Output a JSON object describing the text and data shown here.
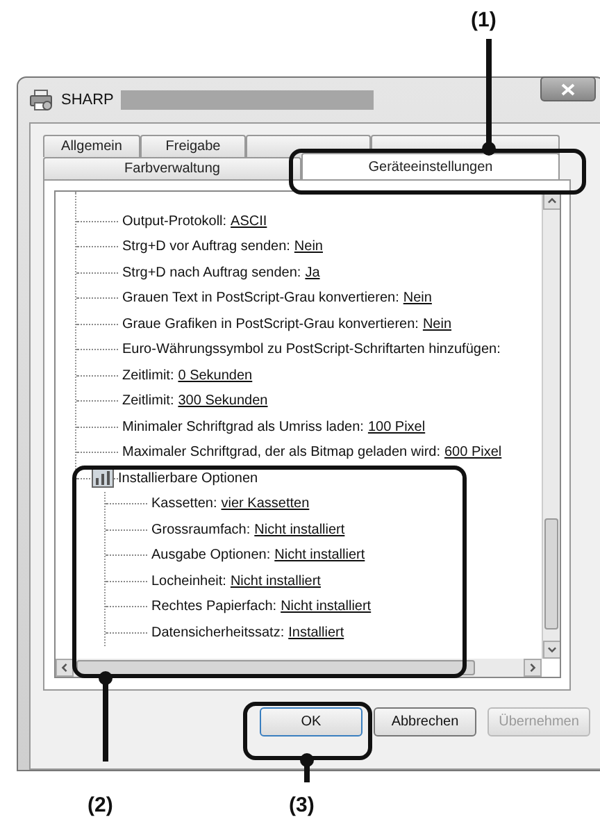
{
  "window": {
    "title": "SHARP"
  },
  "tabs_top": [
    {
      "label": "Allgemein",
      "selected": false
    },
    {
      "label": "Freigabe",
      "selected": false
    }
  ],
  "tabs_bottom": [
    {
      "label": "Farbverwaltung",
      "selected": false
    },
    {
      "label": "Geräteeinstellungen",
      "selected": true
    }
  ],
  "tree": [
    {
      "label": "Output-Protokoll:",
      "value": "ASCII"
    },
    {
      "label": "Strg+D vor Auftrag senden:",
      "value": "Nein"
    },
    {
      "label": "Strg+D nach Auftrag senden:",
      "value": "Ja"
    },
    {
      "label": "Grauen Text in PostScript-Grau konvertieren:",
      "value": "Nein"
    },
    {
      "label": "Graue Grafiken in PostScript-Grau konvertieren:",
      "value": "Nein"
    },
    {
      "label": "Euro-Währungssymbol zu PostScript-Schriftarten hinzufügen:"
    },
    {
      "label": "Zeitlimit:",
      "value": "0 Sekunden"
    },
    {
      "label": "Zeitlimit:",
      "value": "300 Sekunden"
    },
    {
      "label": "Minimaler Schriftgrad als Umriss laden:",
      "value": "100 Pixel"
    },
    {
      "label": "Maximaler Schriftgrad, der als Bitmap geladen wird:",
      "value": "600 Pixel"
    },
    {
      "label": "Installierbare Optionen",
      "children": [
        {
          "label": "Kassetten:",
          "value": "vier Kassetten"
        },
        {
          "label": "Grossraumfach:",
          "value": "Nicht installiert"
        },
        {
          "label": "Ausgabe Optionen:",
          "value": "Nicht installiert"
        },
        {
          "label": "Locheinheit:",
          "value": "Nicht installiert"
        },
        {
          "label": "Rechtes Papierfach:",
          "value": "Nicht installiert"
        },
        {
          "label": "Datensicherheitssatz:",
          "value": "Installiert"
        }
      ]
    }
  ],
  "buttons": [
    {
      "label": "OK",
      "default": true,
      "disabled": false
    },
    {
      "label": "Abbrechen",
      "default": false,
      "disabled": false
    },
    {
      "label": "Übernehmen",
      "default": false,
      "disabled": true
    }
  ],
  "callouts": [
    {
      "label": "(1)"
    },
    {
      "label": "(2)"
    },
    {
      "label": "(3)"
    }
  ]
}
